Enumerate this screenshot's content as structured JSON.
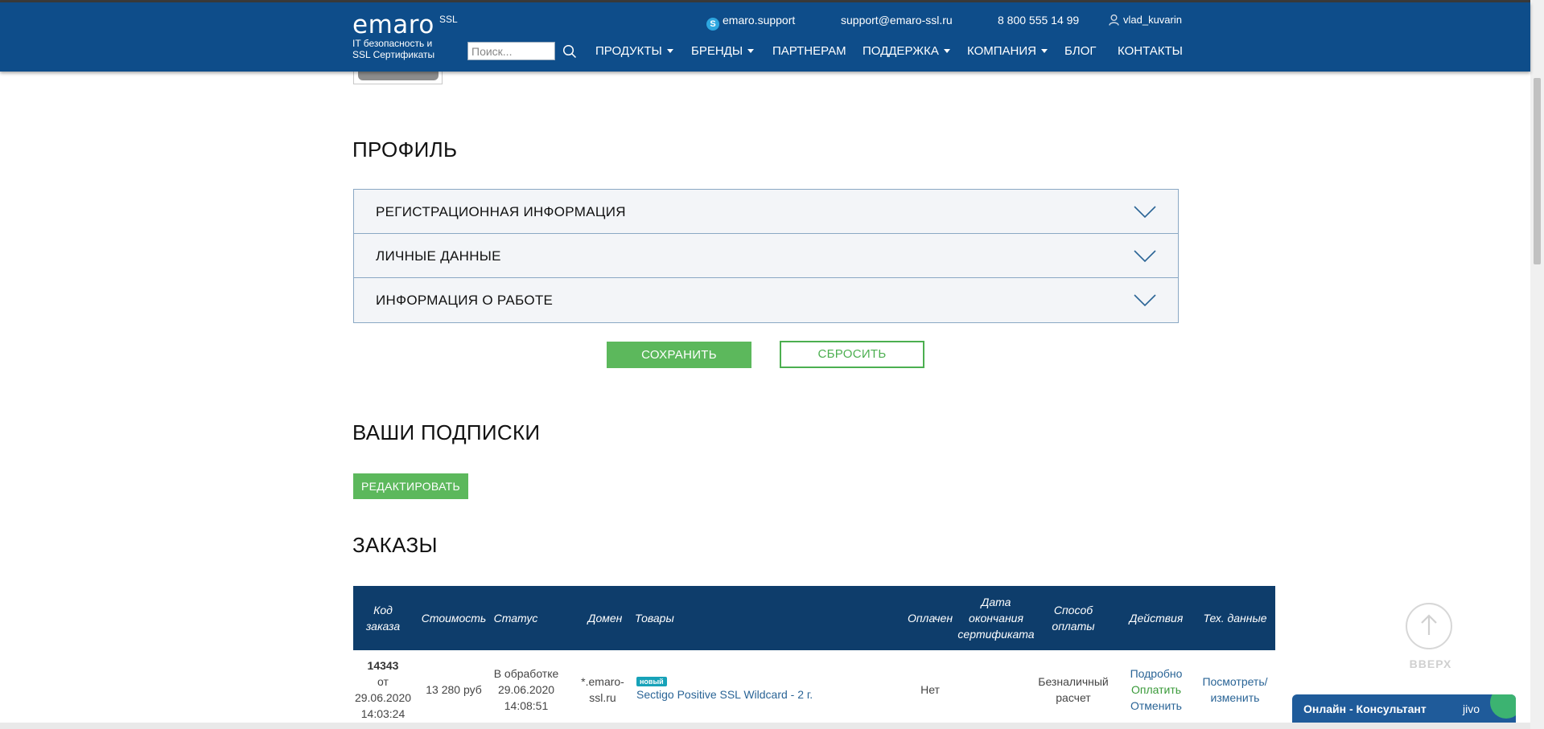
{
  "header": {
    "logo_text": "emaro",
    "logo_superscript": "SSL",
    "tagline": "IT безопасность и\nSSL Сертификаты",
    "skype": "emaro.support",
    "email": "support@emaro-ssl.ru",
    "phone": "8 800 555 14 99",
    "username": "vlad_kuvarin",
    "search_placeholder": "Поиск...",
    "nav": [
      {
        "label": "ПРОДУКТЫ",
        "dropdown": true
      },
      {
        "label": "БРЕНДЫ",
        "dropdown": true
      },
      {
        "label": "ПАРТНЕРАМ",
        "dropdown": false
      },
      {
        "label": "ПОДДЕРЖКА",
        "dropdown": true
      },
      {
        "label": "КОМПАНИЯ",
        "dropdown": true
      },
      {
        "label": "БЛОГ",
        "dropdown": false
      },
      {
        "label": "КОНТАКТЫ",
        "dropdown": false
      }
    ]
  },
  "profile": {
    "title": "ПРОФИЛЬ",
    "sections": [
      {
        "label": "РЕГИСТРАЦИОННАЯ ИНФОРМАЦИЯ"
      },
      {
        "label": "ЛИЧНЫЕ ДАННЫЕ"
      },
      {
        "label": "ИНФОРМАЦИЯ О РАБОТЕ"
      }
    ],
    "save_label": "СОХРАНИТЬ",
    "reset_label": "СБРОСИТЬ"
  },
  "subscriptions": {
    "title": "ВАШИ ПОДПИСКИ",
    "edit_label": "РЕДАКТИРОВАТЬ"
  },
  "orders": {
    "title": "ЗАКАЗЫ",
    "columns": [
      "Код заказа",
      "Стоимость",
      "Статус",
      "Домен",
      "Товары",
      "Оплачен",
      "Дата окончания сертификата",
      "Способ оплаты",
      "Действия",
      "Тех. данные"
    ],
    "rows": [
      {
        "code": "14343",
        "from": "от",
        "date": "29.06.2020",
        "time": "14:03:24",
        "price": "13 280 руб",
        "status": "В обработке",
        "status_date": "29.06.2020",
        "status_time": "14:08:51",
        "domain_line1": "*.emaro-",
        "domain_line2": "ssl.ru",
        "badge": "новый",
        "product": "Sectigo Positive SSL Wildcard - 2 г.",
        "paid": "Нет",
        "expiry": "",
        "payment_line1": "Безналичный",
        "payment_line2": "расчет",
        "action_details": "Подробно",
        "action_pay": "Оплатить",
        "action_cancel": "Отменить",
        "tech_line1": "Посмотреть/",
        "tech_line2": "изменить"
      }
    ]
  },
  "up_button": {
    "label": "ВВЕРХ"
  },
  "chat": {
    "title": "Онлайн - Консультант",
    "brand": "jivo"
  },
  "colors": {
    "header_bg": "#0e4d8a",
    "table_head_bg": "#0e3d6b",
    "accent_green": "#5cb85c",
    "link_blue": "#2a6496"
  }
}
